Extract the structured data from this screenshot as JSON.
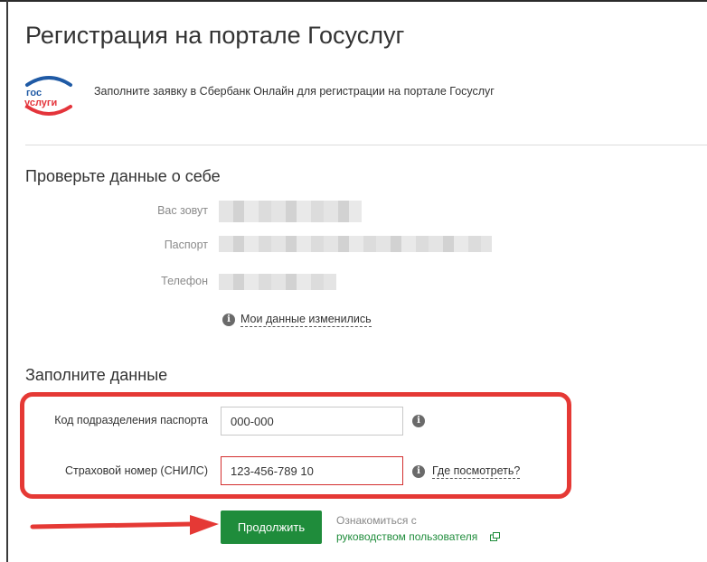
{
  "header": {
    "title": "Регистрация на портале Госуслуг"
  },
  "intro": {
    "logo": {
      "line1": "гос",
      "line2": "услуги"
    },
    "text": "Заполните заявку в Сбербанк Онлайн для регистрации на портале Госуслуг"
  },
  "check_section": {
    "title": "Проверьте данные о себе",
    "rows": [
      {
        "label": "Вас зовут"
      },
      {
        "label": "Паспорт"
      },
      {
        "label": "Телефон"
      }
    ],
    "changed_link": "Мои данные изменились"
  },
  "fill_section": {
    "title": "Заполните данные",
    "passport_code": {
      "label": "Код подразделения паспорта",
      "value": "000-000"
    },
    "snils": {
      "label": "Страховой номер (СНИЛС)",
      "value": "123-456-789 10",
      "help_link": "Где посмотреть?"
    }
  },
  "actions": {
    "continue_label": "Продолжить",
    "guide_prefix": "Ознакомиться с",
    "guide_link": "руководством пользователя"
  },
  "colors": {
    "primary_green": "#1f8c3b",
    "highlight_red": "#e53935",
    "logo_blue": "#1f5aa5",
    "logo_red": "#e4343b"
  },
  "icons": [
    "gosuslugi-logo",
    "info-icon",
    "info-icon",
    "info-icon",
    "external-link-icon",
    "annotation-arrow"
  ]
}
